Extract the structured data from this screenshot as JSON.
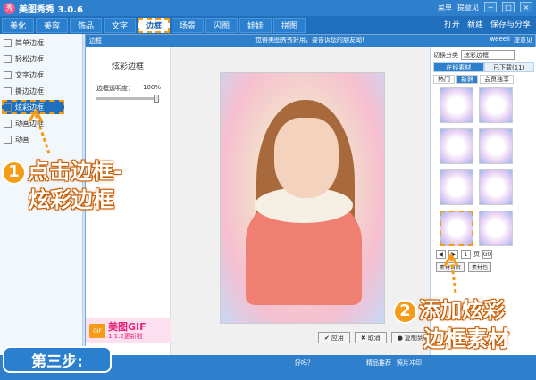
{
  "titlebar": {
    "app_name": "美图秀秀 3.0.6",
    "logo": "秀",
    "menu": "菜单",
    "login": "提意见",
    "min": "─",
    "max": "□",
    "close": "×"
  },
  "navbar": {
    "tabs": [
      "美化",
      "美容",
      "饰品",
      "文字",
      "边框",
      "场景",
      "闪图",
      "娃娃",
      "拼图"
    ],
    "active": "边框",
    "open": "打开",
    "new": "新建",
    "save": "保存与分享"
  },
  "sidebar": {
    "items": [
      "简单边框",
      "轻松边框",
      "文字边框",
      "撕边边框",
      "炫彩边框",
      "动画边框",
      "动画"
    ]
  },
  "dialog": {
    "title": "边框",
    "center_text": "觉得美图秀秀好用，要告诉您的朋友呦!",
    "user": "weeell",
    "feedback": "提意见"
  },
  "left_panel": {
    "title": "炫彩边框",
    "opacity_label": "边框透明度：",
    "opacity_value": "100%",
    "opacity_fraction": 1.0
  },
  "gif_banner": {
    "badge": "GIF",
    "title": "美图GIF",
    "subtitle": "1.1.2更新啦"
  },
  "actions": {
    "apply": "应用",
    "cancel": "取消",
    "copy": "复制到QQ"
  },
  "right_panel": {
    "category_label": "切换分类",
    "category_value": "炫彩边框",
    "tab_online": "在线素材",
    "tab_local": "已下载(11)",
    "subtabs": [
      "热门",
      "新鲜",
      "会员独享"
    ],
    "page": "1",
    "page_suffix": "页",
    "go": "GO",
    "btn_home": "素材首页",
    "btn_pack": "素材包"
  },
  "statusbar": {
    "middle": "好吗？",
    "r1": "精品推荐",
    "r2": "照片冲印"
  },
  "overlay": {
    "step": "第三步:",
    "callout1_num": "1",
    "callout1_line1": "点击边框-",
    "callout1_line2": "炫彩边框",
    "callout2_num": "2",
    "callout2_line1": "添加炫彩",
    "callout2_line2": "边框素材"
  },
  "colors": {
    "accent": "#2f80cc",
    "highlight": "#f59b16"
  }
}
